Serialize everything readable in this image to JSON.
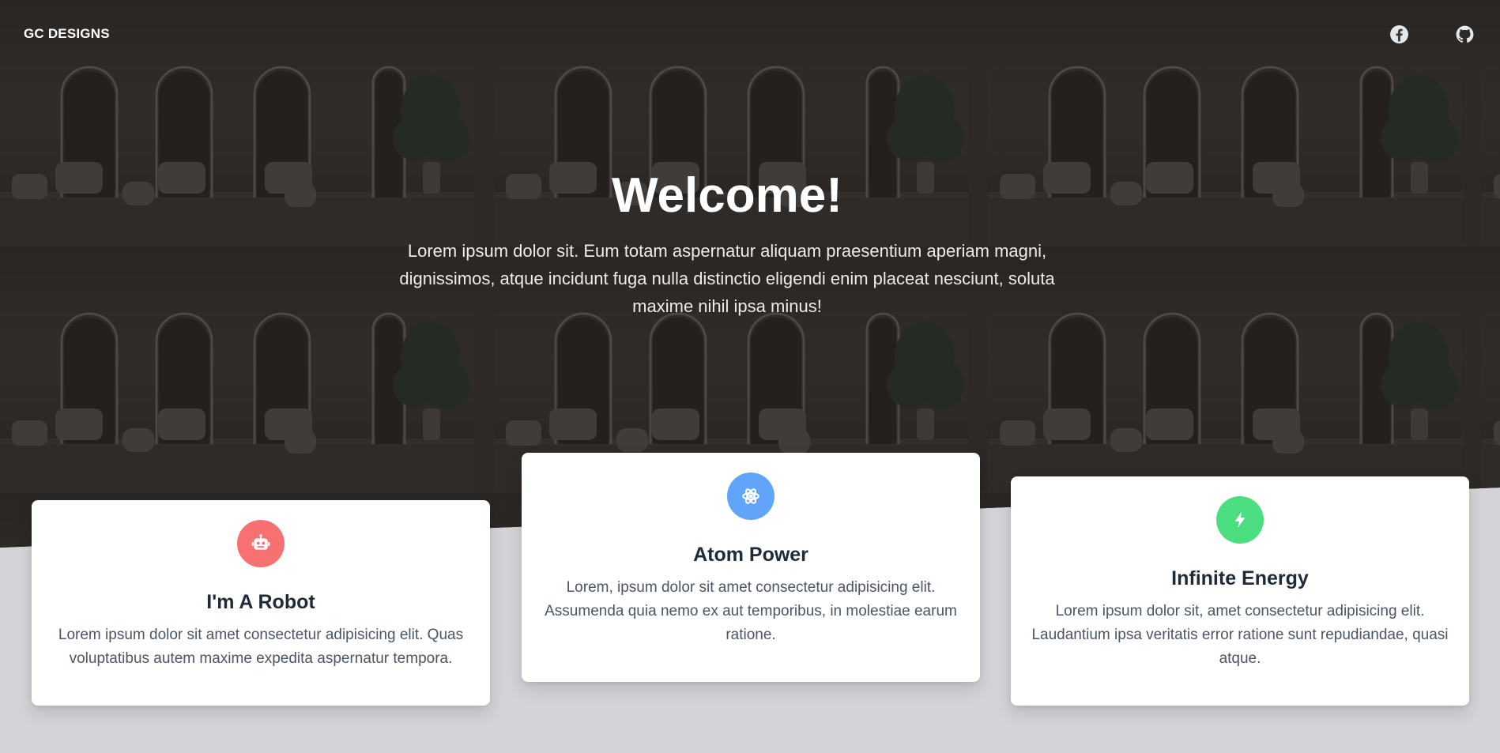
{
  "navbar": {
    "brand": "GC DESIGNS",
    "social": [
      {
        "icon": "facebook-icon"
      },
      {
        "icon": "github-icon"
      }
    ]
  },
  "hero": {
    "title": "Welcome!",
    "text": "Lorem ipsum dolor sit. Eum totam aspernatur aliquam praesentium aperiam magni, dignissimos, atque incidunt fuga nulla distinctio eligendi enim placeat nesciunt, soluta maxime nihil ipsa minus!"
  },
  "cards": [
    {
      "icon": "robot-icon",
      "color": "#f87171",
      "title": "I'm A Robot",
      "text": "Lorem ipsum dolor sit amet consectetur adipisicing elit. Quas voluptatibus autem maxime expedita aspernatur tempora."
    },
    {
      "icon": "atom-icon",
      "color": "#60a5fa",
      "title": "Atom Power",
      "text": "Lorem, ipsum dolor sit amet consectetur adipisicing elit. Assumenda quia nemo ex aut temporibus, in molestiae earum ratione."
    },
    {
      "icon": "bolt-icon",
      "color": "#4ade80",
      "title": "Infinite Energy",
      "text": "Lorem ipsum dolor sit, amet consectetur adipisicing elit. Laudantium ipsa veritatis error ratione sunt repudiandae, quasi atque."
    }
  ],
  "colors": {
    "background": "#d4d4d8",
    "card": "#ffffff"
  }
}
